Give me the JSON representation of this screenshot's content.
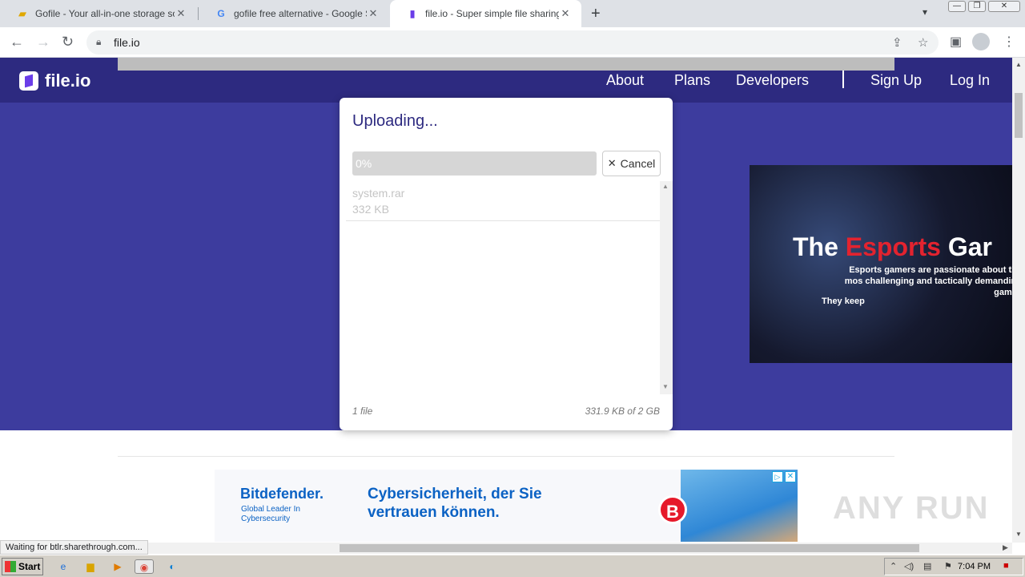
{
  "browser": {
    "tabs": [
      {
        "title": "Gofile - Your all-in-one storage soluti",
        "icon": "gofile-icon"
      },
      {
        "title": "gofile free alternative - Google Suche",
        "icon": "google-icon"
      },
      {
        "title": "file.io - Super simple file sharing",
        "icon": "fileio-icon"
      }
    ],
    "url": "file.io",
    "status": "Waiting for btlr.sharethrough.com..."
  },
  "site": {
    "logo": "file.io",
    "nav": [
      "About",
      "Plans",
      "Developers",
      "Sign Up",
      "Log In"
    ]
  },
  "upload": {
    "title": "Uploading...",
    "progress_label": "0%",
    "progress_value": 0,
    "cancel": "Cancel",
    "file_name": "system.rar",
    "file_size": "332 KB",
    "count": "1 file",
    "total": "331.9 KB of 2 GB"
  },
  "ad_right": {
    "headline_1": "The ",
    "headline_2": "Esports",
    "headline_3": " Gar",
    "sub": "Esports gamers are passionate about the mos challenging and tactically demanding games",
    "keep": "They keep"
  },
  "ad_bottom": {
    "brand": "Bitdefender.",
    "tagline": "Global Leader In Cybersecurity",
    "message": "Cybersicherheit, der Sie vertrauen können.",
    "logo_letter": "B"
  },
  "watermark": "ANY RUN",
  "taskbar": {
    "start": "Start",
    "time": "7:04 PM"
  },
  "colors": {
    "header": "#2d2a80",
    "hero": "#3d3c9e",
    "accent": "#6a3de8"
  }
}
